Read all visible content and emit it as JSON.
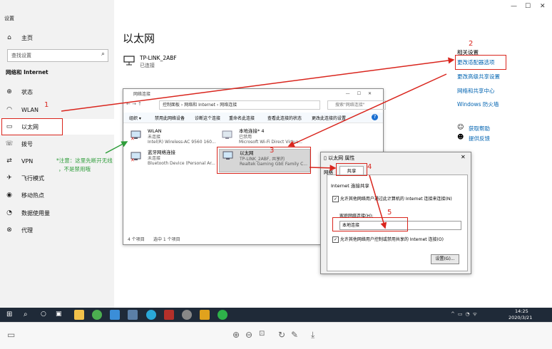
{
  "window": {
    "title": "设置",
    "min": "—",
    "max": "☐",
    "close": "✕"
  },
  "sidebar": {
    "home": "主页",
    "search_placeholder": "查找设置",
    "section": "网络和 Internet",
    "items": [
      {
        "icon": "globe-icon",
        "label": "状态"
      },
      {
        "icon": "wifi-icon",
        "label": "WLAN"
      },
      {
        "icon": "ethernet-icon",
        "label": "以太网"
      },
      {
        "icon": "dialup-icon",
        "label": "拨号"
      },
      {
        "icon": "vpn-icon",
        "label": "VPN"
      },
      {
        "icon": "airplane-icon",
        "label": "飞行模式"
      },
      {
        "icon": "hotspot-icon",
        "label": "移动热点"
      },
      {
        "icon": "data-usage-icon",
        "label": "数据使用量"
      },
      {
        "icon": "proxy-icon",
        "label": "代理"
      }
    ]
  },
  "main": {
    "title": "以太网",
    "network_name": "TP-LINK_2ABF",
    "network_status": "已连接"
  },
  "related": {
    "heading": "相关设置",
    "links": [
      "更改适配器选项",
      "更改高级共享设置",
      "网络和共享中心",
      "Windows 防火墙"
    ],
    "help": "获取帮助",
    "feedback": "提供反馈"
  },
  "netconn": {
    "title": "网络连接",
    "breadcrumb": [
      "控制面板",
      "网络和 Internet",
      "网络连接"
    ],
    "search": "搜索\"网络连接\"",
    "toolbar": [
      "组织 ▾",
      "禁用此网络设备",
      "诊断这个连接",
      "重命名此连接",
      "查看此连接的状态",
      "更改此连接的设置"
    ],
    "adapters": [
      {
        "name": "WLAN",
        "status": "未连接",
        "device": "Intel(R) Wireless-AC 9560 160..."
      },
      {
        "name": "本地连接* 4",
        "status": "已禁用",
        "device": "Microsoft Wi-Fi Direct Virtua..."
      },
      {
        "name": "蓝牙网络连接",
        "status": "未连接",
        "device": "Bluetooth Device (Personal Ar..."
      },
      {
        "name": "以太网",
        "status": "TP-LINK_2ABF, 共享的",
        "device": "Realtek Gaming GbE Family C..."
      }
    ],
    "footer_items": "4 个项目",
    "footer_selected": "选中 1 个项目"
  },
  "props": {
    "title": "以太网 属性",
    "tabs": [
      "网络",
      "共享"
    ],
    "group": "Internet 连接共享",
    "allow_label": "允许其他网络用户通过此计算机的 Internet 连接来连接(N)",
    "home_label": "家庭网络连接(H):",
    "home_value": "本地连接",
    "control_label": "允许其他网络用户控制或禁用共享的 Internet 连接(O)",
    "settings_button": "设置(G)..."
  },
  "annotations": {
    "n1": "1",
    "n2": "2",
    "n3": "3",
    "n4": "4",
    "n5": "5",
    "note_line1": "*注意：这里先断开无线",
    "note_line2": "，不是禁用哦"
  },
  "taskbar": {
    "time": "14:25",
    "date": "2020/3/21"
  },
  "colors": {
    "accent": "#0063b1",
    "annotation": "#d9251d",
    "note": "#2e9d3a",
    "taskbar": "#1f2a38"
  }
}
